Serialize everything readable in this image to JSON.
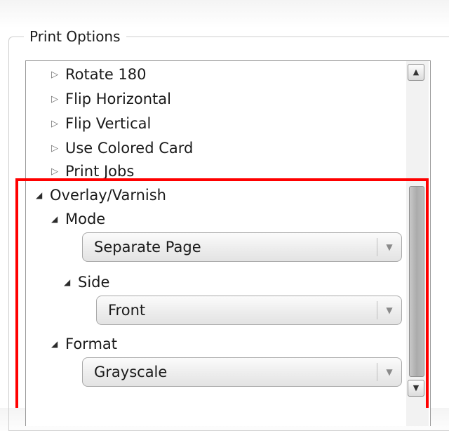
{
  "group": {
    "title": "Print Options"
  },
  "tree": {
    "items": [
      {
        "label": "Rotate 180",
        "expanded": false,
        "icon": "triangle-right-icon"
      },
      {
        "label": "Flip Horizontal",
        "expanded": false,
        "icon": "triangle-right-icon"
      },
      {
        "label": "Flip Vertical",
        "expanded": false,
        "icon": "triangle-right-icon"
      },
      {
        "label": "Use Colored Card",
        "expanded": false,
        "icon": "triangle-right-icon"
      },
      {
        "label": "Print Jobs",
        "expanded": false,
        "icon": "triangle-right-icon"
      },
      {
        "label": "Overlay/Varnish",
        "expanded": true,
        "icon": "triangle-down-icon"
      },
      {
        "label": "Mode",
        "expanded": true,
        "icon": "triangle-down-icon"
      },
      {
        "label": "Side",
        "expanded": true,
        "icon": "triangle-down-icon"
      },
      {
        "label": "Format",
        "expanded": true,
        "icon": "triangle-down-icon"
      }
    ],
    "collapsed_glyph": "▷",
    "expanded_glyph": "◢"
  },
  "combos": {
    "mode": {
      "value": "Separate Page",
      "arrow": "▼"
    },
    "side": {
      "value": "Front",
      "arrow": "▼"
    },
    "format": {
      "value": "Grayscale",
      "arrow": "▼"
    }
  },
  "scrollbar": {
    "up_glyph": "▲",
    "down_glyph": "▼"
  },
  "colors": {
    "highlight": "#ff0000",
    "border": "#9a9a9a"
  }
}
